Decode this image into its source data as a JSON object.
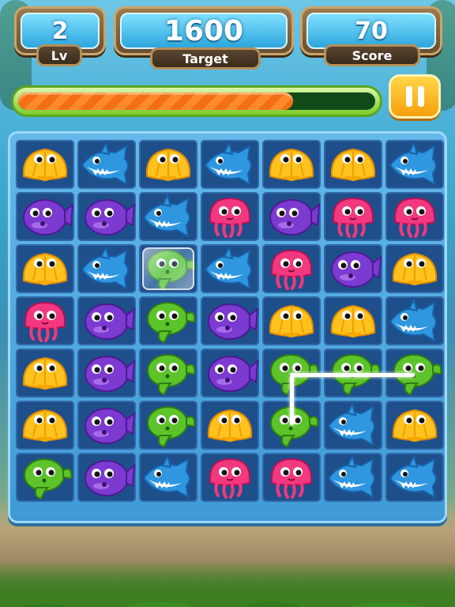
{
  "header": {
    "level": {
      "value": "2",
      "label": "Lv"
    },
    "target": {
      "value": "1600",
      "label": "Target"
    },
    "score": {
      "value": "70",
      "label": "Score"
    }
  },
  "progress": {
    "value": 0.77
  },
  "board": {
    "rows": [
      [
        "shell",
        "shark",
        "shell",
        "shark",
        "shell",
        "shell",
        "shark"
      ],
      [
        "purple",
        "purple",
        "shark",
        "jelly",
        "purple",
        "jelly",
        "jelly"
      ],
      [
        "shell",
        "shark",
        "green",
        "shark",
        "jelly",
        "purple",
        "shell"
      ],
      [
        "jelly",
        "purple",
        "green",
        "purple",
        "shell",
        "shell",
        "shark"
      ],
      [
        "shell",
        "purple",
        "green",
        "purple",
        "green",
        "green",
        "green"
      ],
      [
        "shell",
        "purple",
        "green",
        "shell",
        "green",
        "shark",
        "shell"
      ],
      [
        "green",
        "purple",
        "shark",
        "jelly",
        "jelly",
        "shark",
        "shark"
      ]
    ],
    "frozen": [
      [
        2,
        2
      ]
    ],
    "piece_colors": {
      "shell": "#ffc21f",
      "shark": "#2f96e0",
      "purple": "#7c3ad1",
      "jelly": "#f2387e",
      "green": "#5cc42a"
    }
  },
  "icons": {
    "pause": "pause-icon"
  }
}
